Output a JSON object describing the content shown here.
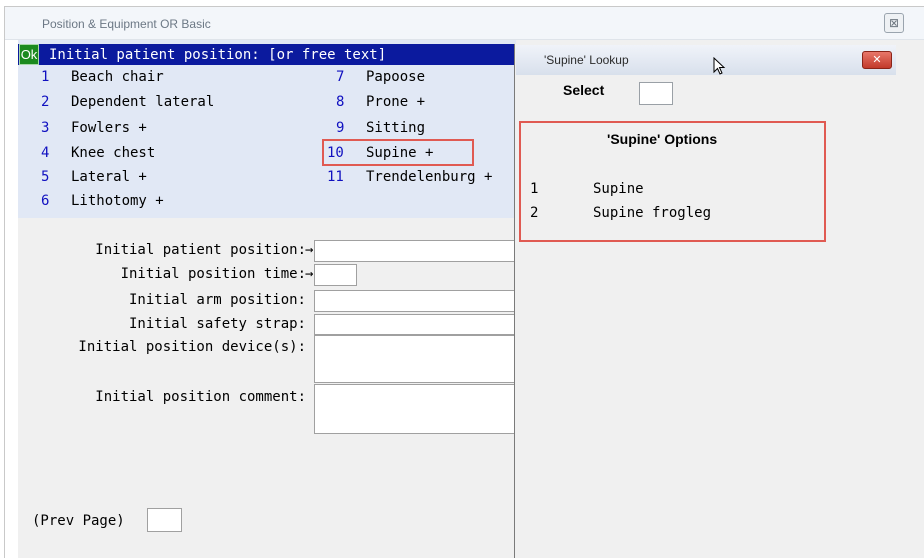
{
  "window": {
    "title": "Position & Equipment OR Basic",
    "close_glyph": "⊠"
  },
  "prompt": {
    "ok_label": "Ok",
    "text": "Initial patient position: [or free text]"
  },
  "choices_left": [
    {
      "num": "1",
      "label": "Beach chair"
    },
    {
      "num": "2",
      "label": "Dependent lateral"
    },
    {
      "num": "3",
      "label": "Fowlers +"
    },
    {
      "num": "4",
      "label": "Knee chest"
    },
    {
      "num": "5",
      "label": "Lateral +"
    },
    {
      "num": "6",
      "label": "Lithotomy +"
    }
  ],
  "choices_right": [
    {
      "num": "7",
      "label": "Papoose"
    },
    {
      "num": "8",
      "label": "Prone +"
    },
    {
      "num": "9",
      "label": "Sitting"
    },
    {
      "num": "10",
      "label": "Supine +"
    },
    {
      "num": "11",
      "label": "Trendelenburg +"
    }
  ],
  "form": {
    "patient_position_label": "Initial patient position:",
    "position_time_label": "Initial position time:",
    "arm_position_label": "Initial arm position:",
    "safety_strap_label": "Initial safety strap:",
    "position_device_label": "Initial position device(s):",
    "position_comment_label": "Initial position comment:",
    "arrow_glyph": "→"
  },
  "footer": {
    "prev_page_label": "(Prev Page)"
  },
  "lookup": {
    "title": "'Supine' Lookup",
    "close_glyph": "✕",
    "select_label": "Select",
    "options_heading": "'Supine' Options",
    "options": [
      {
        "num": "1",
        "label": "Supine"
      },
      {
        "num": "2",
        "label": "Supine frogleg"
      }
    ]
  },
  "colors": {
    "prompt_bar": "#0b1a9e",
    "ok_badge": "#1b8a1f",
    "choice_panel": "#e1e8f5",
    "number_text": "#1010c0",
    "highlight_box": "#e05a52"
  }
}
